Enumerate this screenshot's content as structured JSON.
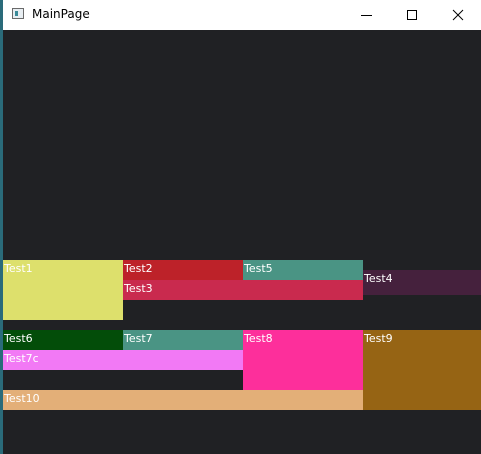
{
  "window": {
    "title": "MainPage",
    "minimize_glyph": "minimize-icon",
    "maximize_glyph": "maximize-icon",
    "close_glyph": "close-icon"
  },
  "blocks": {
    "test1": {
      "label": "Test1",
      "bg": "#dde06c",
      "fg": "#ffffff"
    },
    "test2": {
      "label": "Test2",
      "bg": "#bd2229",
      "fg": "#ffffff"
    },
    "test3": {
      "label": "Test3",
      "bg": "#c92a4e",
      "fg": "#ffffff"
    },
    "test5": {
      "label": "Test5",
      "bg": "#4a9484",
      "fg": "#ffffff"
    },
    "test4": {
      "label": "Test4",
      "bg": "#45213d",
      "fg": "#ffffff"
    },
    "test6": {
      "label": "Test6",
      "bg": "#034d09",
      "fg": "#ffffff"
    },
    "test7": {
      "label": "Test7",
      "bg": "#4a9484",
      "fg": "#ffffff"
    },
    "test8": {
      "label": "Test8",
      "bg": "#fd2f9b",
      "fg": "#ffffff"
    },
    "test9": {
      "label": "Test9",
      "bg": "#966414",
      "fg": "#ffffff"
    },
    "test7c": {
      "label": "Test7c",
      "bg": "#f279f5",
      "fg": "#ffffff"
    },
    "test10": {
      "label": "Test10",
      "bg": "#e3af78",
      "fg": "#ffffff"
    }
  }
}
